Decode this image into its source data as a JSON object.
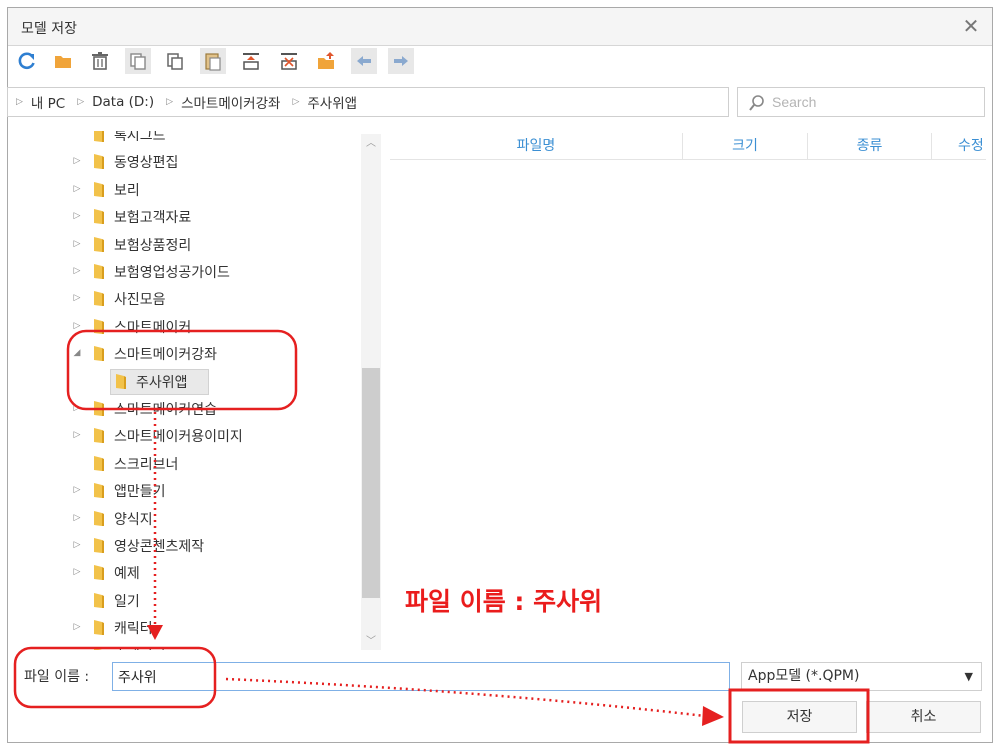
{
  "window": {
    "title": "모델 저장",
    "close_glyph": "✕"
  },
  "toolbar": {
    "icons": [
      "refresh-icon",
      "new-folder-icon",
      "delete-icon",
      "copy-icon",
      "duplicate-icon",
      "paste-icon",
      "move-top-icon",
      "move-bottom-icon",
      "export-icon",
      "back-arrow-icon",
      "forward-arrow-icon"
    ]
  },
  "address": {
    "segments": [
      "내 PC",
      "Data (D:)",
      "스마트메이커강좌",
      "주사위앱"
    ]
  },
  "search": {
    "placeholder": "Search",
    "value": ""
  },
  "tree": {
    "items": [
      {
        "label": "록시그드",
        "expanded": false,
        "has_children": false
      },
      {
        "label": "동영상편집",
        "expanded": false,
        "has_children": true
      },
      {
        "label": "보리",
        "expanded": false,
        "has_children": true
      },
      {
        "label": "보험고객자료",
        "expanded": false,
        "has_children": true
      },
      {
        "label": "보험상품정리",
        "expanded": false,
        "has_children": true
      },
      {
        "label": "보험영업성공가이드",
        "expanded": false,
        "has_children": true
      },
      {
        "label": "사진모음",
        "expanded": false,
        "has_children": true
      },
      {
        "label": "스마트메이커",
        "expanded": false,
        "has_children": true
      },
      {
        "label": "스마트메이커강좌",
        "expanded": true,
        "has_children": true
      },
      {
        "label": "주사위앱",
        "expanded": false,
        "has_children": false,
        "child": true,
        "selected": true
      },
      {
        "label": "스마트메이커연습",
        "expanded": false,
        "has_children": true
      },
      {
        "label": "스마트메이커용이미지",
        "expanded": false,
        "has_children": true
      },
      {
        "label": "스크리브너",
        "expanded": false,
        "has_children": false
      },
      {
        "label": "앱만들기",
        "expanded": false,
        "has_children": true
      },
      {
        "label": "양식지",
        "expanded": false,
        "has_children": true
      },
      {
        "label": "영상콘첸츠제작",
        "expanded": false,
        "has_children": true
      },
      {
        "label": "예제",
        "expanded": false,
        "has_children": true
      },
      {
        "label": "일기",
        "expanded": false,
        "has_children": false
      },
      {
        "label": "캐릭터",
        "expanded": false,
        "has_children": true
      },
      {
        "label": "홈페이지",
        "expanded": false,
        "has_children": true
      }
    ]
  },
  "list": {
    "columns": [
      "파일명",
      "크기",
      "종류",
      "수정"
    ]
  },
  "footer": {
    "filename_label": "파일 이름 :",
    "filename_value": "주사위",
    "filetype": "App모델 (*.QPM)",
    "save_label": "저장",
    "cancel_label": "취소"
  },
  "annotation": {
    "text": "파일 이름 : 주사위",
    "color": "#ea1c1c"
  },
  "colors": {
    "folder": "#f2c24a",
    "header_text": "#3b8fd3",
    "accent": "#e52020"
  }
}
